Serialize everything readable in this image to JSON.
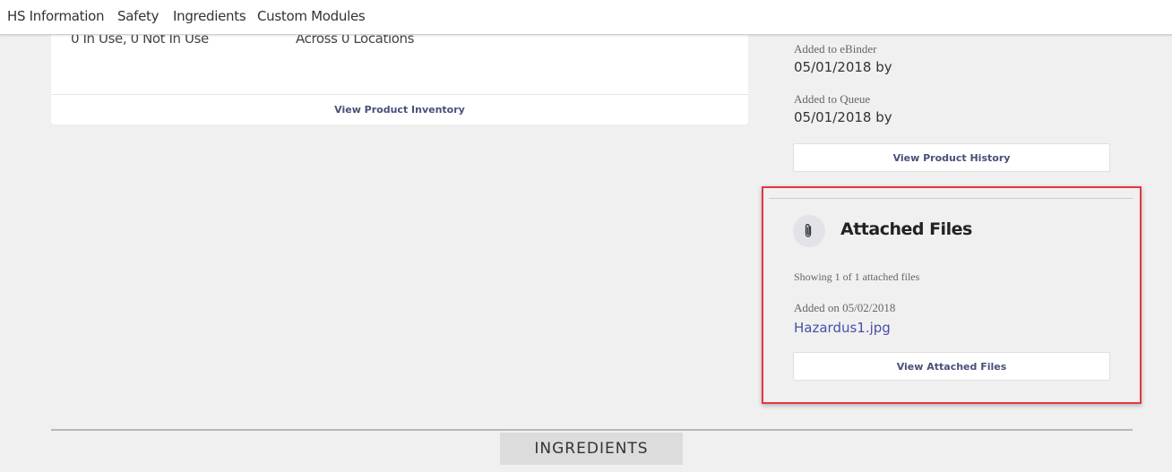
{
  "nav": {
    "items": [
      "HS Information",
      "Safety",
      "Ingredients",
      "Custom Modules"
    ]
  },
  "inventory_card": {
    "usage_text": "0 In Use, 0 Not In Use",
    "locations_text": "Across 0 Locations",
    "view_inventory_label": "View Product Inventory"
  },
  "history": {
    "added_to_ebinder_label": "Added to eBinder",
    "added_to_ebinder_value": "05/01/2018 by",
    "added_to_queue_label": "Added to Queue",
    "added_to_queue_value": "05/01/2018 by",
    "view_history_label": "View Product History"
  },
  "attached_files": {
    "icon": "paperclip-icon",
    "title": "Attached Files",
    "showing_text": "Showing 1 of 1 attached files",
    "added_on": "Added on 05/02/2018",
    "file_name": "Hazardus1.jpg",
    "view_files_label": "View Attached Files"
  },
  "ingredients_tab": {
    "label": "INGREDIENTS"
  },
  "colors": {
    "highlight_border": "#e0393e",
    "link": "#4750a8",
    "button_text": "#4a4f7a",
    "page_background": "#f0f0f0"
  }
}
